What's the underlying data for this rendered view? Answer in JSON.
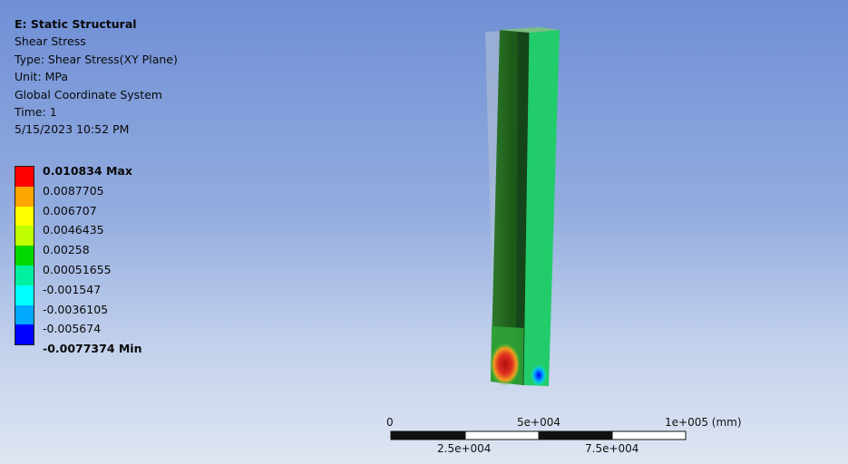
{
  "info": {
    "title": "E: Static Structural",
    "result_name": "Shear Stress",
    "type": "Type: Shear Stress(XY Plane)",
    "unit": "Unit: MPa",
    "coordinate_system": "Global Coordinate System",
    "time": "Time: 1",
    "timestamp": "5/15/2023 10:52 PM"
  },
  "legend": {
    "max_label": "0.010834 Max",
    "min_label": "-0.0077374 Min",
    "values": [
      "0.0087705",
      "0.006707",
      "0.0046435",
      "0.00258",
      "0.00051655",
      "-0.001547",
      "-0.0036105",
      "-0.005674"
    ],
    "colors": [
      "#ff0000",
      "#ffa500",
      "#ffff00",
      "#bfff00",
      "#00d800",
      "#00f0a0",
      "#00ffff",
      "#00a8ff",
      "#0000ff"
    ]
  },
  "scale_bar": {
    "top_labels": [
      "0",
      "5e+004",
      "1e+005 (mm)"
    ],
    "bottom_labels": [
      "2.5e+004",
      "7.5e+004"
    ]
  },
  "model_colors": {
    "front_face": "#22cc6a",
    "side_face": "#1c5b18",
    "top_face": "#7bbf82",
    "hot_spot": "#d42020",
    "cold_spot": "#1060ff",
    "undeformed_ghost": "#b7c3d4"
  }
}
